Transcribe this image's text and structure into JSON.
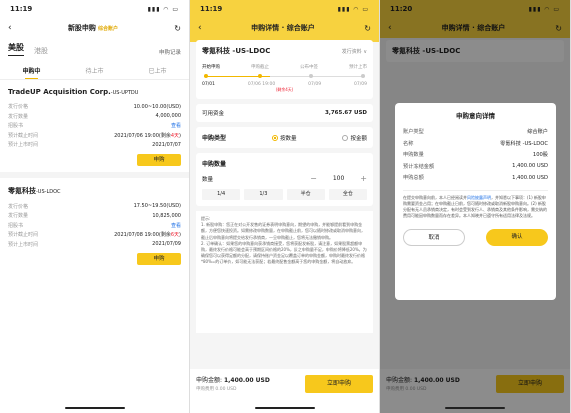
{
  "p1": {
    "time": "11:19",
    "title": "新股申购",
    "badge": "综合账户",
    "markets": [
      "美股",
      "港股"
    ],
    "record": "申购记录",
    "tabs": [
      "申购中",
      "待上市",
      "已上市"
    ],
    "stocks": [
      {
        "name": "TradeUP Acquisition Corp.",
        "code": "-US-UPTDU",
        "rows": [
          [
            "发行价格",
            "10.00~10.00(USD)"
          ],
          [
            "发行数量",
            "4,000,000"
          ],
          [
            "招股书",
            "查看"
          ],
          [
            "预计截止时间",
            "2021/07/06 19:00(剩余4天)"
          ],
          [
            "预计上市时间",
            "2021/07/07"
          ]
        ],
        "btn": "申购"
      },
      {
        "name": "零氪科技",
        "code": "-US-LDOC",
        "rows": [
          [
            "发行价格",
            "17.50~19.50(USD)"
          ],
          [
            "发行数量",
            "10,825,000"
          ],
          [
            "招股书",
            "查看"
          ],
          [
            "预计截止时间",
            "2021/07/08 19:00(剩余6天)"
          ],
          [
            "预计上市时间",
            "2021/07/09"
          ]
        ],
        "btn": "申购"
      }
    ]
  },
  "p2": {
    "time": "11:19",
    "title": "申购详情 · 综合账户",
    "name": "零氪科技 -US-LDOC",
    "detail": "发行资料 ∨",
    "tl": [
      "开始申购",
      "申购截止",
      "公布中签",
      "预计上市"
    ],
    "dates": [
      "07/01",
      "07/06 19:00",
      "07/09",
      "07/09"
    ],
    "sub": "(剩余4天)",
    "funds_label": "可用资金",
    "funds": "3,765.67 USD",
    "type_label": "申购类型",
    "opt1": "按数量",
    "opt2": "按金额",
    "qty_title": "申购数量",
    "qty_label": "数量",
    "qty": "100",
    "fr": [
      "1/4",
      "1/3",
      "半仓",
      "全仓"
    ],
    "notes": "提示:\n1. 新股申购：您正在对公开发售的证券表明申购意向，期望的申购，并能够提前看到申购金额，方便您快速投资。如需修改申购数量，在申购截止前，您可以随时修改或取消申购意向，截止后申购意向将提交给发行承销商，一旦申购截止，您将无法撤销申购。\n2. 订单确认：如果您的申购意向获承销商接受，您将获配发新股，请注意，如果股票超额申购，最终发行价格可能会高于预期区间价格的20%，反之申购量不足，申购价将降低20%，为确保您可以获得足额的分配，请保持账户资金足以覆盖订单的申购金额，申购时最终发行价格*80%=的订单价，如可能无法获配；若最终配售金额高于您的申购金额，将自动放弃。",
    "total_label": "申购金额:",
    "total": "1,400.00 USD",
    "fee": "申购费用 0.00 USD",
    "go": "立即申购"
  },
  "p3": {
    "time": "11:20",
    "title": "申购意向详情",
    "rows": [
      [
        "账户类型",
        "综合账户"
      ],
      [
        "名称",
        "零氪科技 -US-LDOC"
      ],
      [
        "申购数量",
        "100股"
      ],
      [
        "预计冻结金额",
        "1,400.00 USD"
      ],
      [
        "申购总额",
        "1,400.00 USD"
      ]
    ],
    "note1": "在提交申购意向前，本人已经阅读并",
    "link": "风险披露声明",
    "note2": "，并知悉以下事项：(1) 新股申购需要资金占用；在申购截止日前，您可随时修改或取消新股申购意向。(2) 新股分配有无人员承销商决定，有时会受到发行人、承销商及其他条件影响，需交纳的费用可能因申购数量而存在差异。本人知晓并已遵守所有适用法律及法规。",
    "cancel": "取消",
    "ok": "确认"
  }
}
